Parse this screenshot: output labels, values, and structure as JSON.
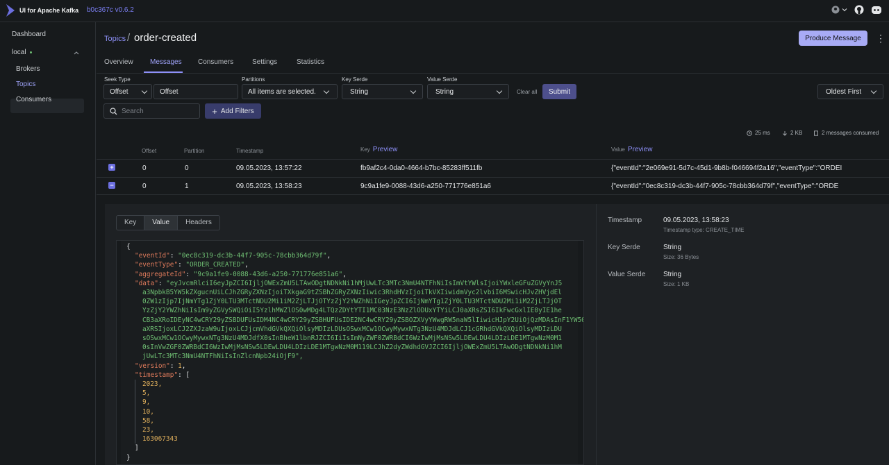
{
  "app": {
    "title": "UI for Apache Kafka",
    "version": "b0c367c v0.6.2"
  },
  "sidebar": {
    "dashboard": "Dashboard",
    "cluster": "local",
    "items": [
      {
        "label": "Brokers"
      },
      {
        "label": "Topics"
      },
      {
        "label": "Consumers"
      }
    ]
  },
  "header": {
    "breadcrumb_topics": "Topics",
    "separator": "/",
    "topic": "order-created",
    "produce_label": "Produce Message"
  },
  "tabs": [
    {
      "label": "Overview"
    },
    {
      "label": "Messages"
    },
    {
      "label": "Consumers"
    },
    {
      "label": "Settings"
    },
    {
      "label": "Statistics"
    }
  ],
  "filters": {
    "seek_type_label": "Seek Type",
    "seek_type_value": "Offset",
    "offset_value": "Offset",
    "partitions_label": "Partitions",
    "partitions_value": "All items are selected.",
    "key_serde_label": "Key Serde",
    "key_serde_value": "String",
    "value_serde_label": "Value Serde",
    "value_serde_value": "String",
    "clear_all": "Clear all",
    "submit": "Submit",
    "order": "Oldest First",
    "search_placeholder": "Search",
    "add_filters": "Add Filters"
  },
  "stats": {
    "time": "25 ms",
    "size": "2 KB",
    "consumed": "2 messages consumed"
  },
  "table": {
    "headers": {
      "offset": "Offset",
      "partition": "Partition",
      "timestamp": "Timestamp",
      "key": "Key",
      "value": "Value",
      "preview": "Preview"
    },
    "rows": [
      {
        "toggle": "+",
        "offset": "0",
        "partition": "0",
        "timestamp": "09.05.2023, 13:57:22",
        "key": "fb9af2c4-0da0-4664-b7bc-85283ff511fb",
        "value": "{\"eventId\":\"2e069e91-5d7c-45d1-9b8b-f046694f2a16\",\"eventType\":\"ORDEI"
      },
      {
        "toggle": "−",
        "offset": "0",
        "partition": "1",
        "timestamp": "09.05.2023, 13:58:23",
        "key": "9c9a1fe9-0088-43d6-a250-771776e851a6",
        "value": "{\"eventId\":\"0ec8c319-dc3b-44f7-905c-78cbb364d79f\",\"eventType\":\"ORDE"
      }
    ]
  },
  "detail": {
    "tabs": [
      {
        "label": "Key"
      },
      {
        "label": "Value"
      },
      {
        "label": "Headers"
      }
    ],
    "json": {
      "open": "{",
      "eventId_key": "\"eventId\"",
      "eventId_val": "\"0ec8c319-dc3b-44f7-905c-78cbb364d79f\"",
      "eventType_key": "\"eventType\"",
      "eventType_val": "\"ORDER_CREATED\"",
      "aggregateId_key": "\"aggregateId\"",
      "aggregateId_val": "\"9c9a1fe9-0088-43d6-a250-771776e851a6\"",
      "data_key": "\"data\"",
      "data_lines": [
        "\"eyJvcmRlciI6eyJpZCI6IjljOWExZmU5LTAwODgtNDNkNi1hMjUwLTc3MTc3NmU4NTFhNiIsImVtYWlsIjoiYWxleGFuZGVyYnJ5",
        "a3NpbkB5YW5kZXgucnUiLCJhZGRyZXNzIjoiTXkgaG9tZSBhZGRyZXNzIiwic3RhdHVzIjoiTkVXIiwidmVyc2lvbiI6MSwicHJvZHVjdEl",
        "0ZW1zIjp7IjNmYTg1ZjY0LTU3MTctNDU2Mi1iM2ZjLTJjOTYzZjY2YWZhNiIGeyJpZCI6IjNmYTg1ZjY0LTU3MTctNDU2Mi1iM2ZjLTJjOT",
        "YzZjY2YWZhNiIsIm9yZGVySWQiOiI5YzlhMWZlOS0wMDg4LTQzZDYtYTI1MC03NzE3NzZlODUxYTYiLCJ0aXRsZSI6IkFwcGxlIE0yIE1he",
        "CB3aXRoIDEyNC4wCRY29yZSBDUFUsIDM4NC4wCRY29yZSBHUFUsIDE2NC4wCRY29yZSBOZXVyYWwgRW5naW5lIiwicHJpY2UiOjQzMDAsInF1YW50",
        "aXRSIjoxLCJ2ZXJzaW9uIjoxLCJjcmVhdGVkQXQiOlsyMDIzLDUsOSwxMCw1OCwyMywxNTg3NzU4MDJdLCJ1cGRhdGVkQXQiOlsyMDIzLDU",
        "sOSwxMCw1OCwyMywxNTg3NzU4MDJdfX0sInBheW1lbnRJZCI6IiIsImNyZWF0ZWRBdCI6WzIwMjMsNSw5LDEwLDU4LDIzLDE1MTgwNzM0M1",
        "0sInVwZGF0ZWRBdCI6WzIwMjMsNSw5LDEwLDU4LDIzLDE1MTgwNzM0M119LCJhZ2dyZWdhdGVJZCI6IjljOWExZmU5LTAwODgtNDNkNi1hM",
        "jUwLTc3MTc3NmU4NTFhNiIsInZlcnNpb24iOjF9\","
      ],
      "version_key": "\"version\"",
      "version_val": "1",
      "timestamp_key": "\"timestamp\"",
      "timestamp_vals": [
        "2023,",
        "5,",
        "9,",
        "10,",
        "58,",
        "23,",
        "163067343"
      ],
      "close_bracket": "]",
      "close": "}"
    },
    "meta": {
      "timestamp_label": "Timestamp",
      "timestamp_value": "09.05.2023, 13:58:23",
      "timestamp_type": "Timestamp type: CREATE_TIME",
      "key_serde_label": "Key Serde",
      "key_serde_value": "String",
      "key_size": "Size: 36 Bytes",
      "value_serde_label": "Value Serde",
      "value_serde_value": "String",
      "value_size": "Size: 1 KB"
    }
  },
  "colors": {
    "accent": "#8e90f8",
    "background": "#171a1c",
    "json_key": "#e07b5c",
    "json_string": "#6fbf73",
    "json_number": "#e0b05c"
  }
}
